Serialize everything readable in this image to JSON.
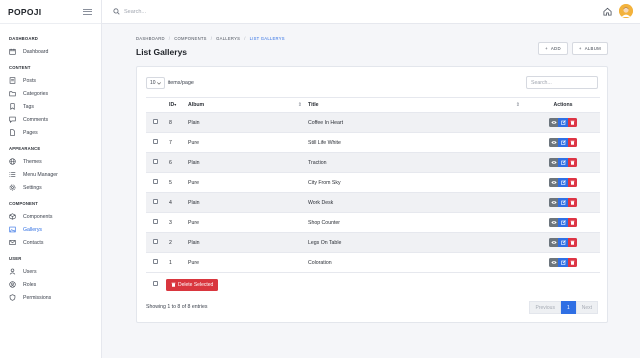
{
  "app": {
    "brand": "POPOJI"
  },
  "search": {
    "placeholder": "Search..."
  },
  "sidebar": {
    "sections": [
      {
        "title": "DASHBOARD",
        "items": [
          {
            "label": "Dashboard",
            "icon": "calendar-icon"
          }
        ]
      },
      {
        "title": "CONTENT",
        "items": [
          {
            "label": "Posts",
            "icon": "document-icon"
          },
          {
            "label": "Categories",
            "icon": "folder-icon"
          },
          {
            "label": "Tags",
            "icon": "bookmark-icon"
          },
          {
            "label": "Comments",
            "icon": "comment-icon"
          },
          {
            "label": "Pages",
            "icon": "page-icon"
          }
        ]
      },
      {
        "title": "APPEARANCE",
        "items": [
          {
            "label": "Themes",
            "icon": "globe-icon"
          },
          {
            "label": "Menu Manager",
            "icon": "list-icon"
          },
          {
            "label": "Settings",
            "icon": "gear-icon"
          }
        ]
      },
      {
        "title": "COMPONENT",
        "items": [
          {
            "label": "Components",
            "icon": "box-icon"
          },
          {
            "label": "Gallerys",
            "icon": "image-icon",
            "active": true
          },
          {
            "label": "Contacts",
            "icon": "mail-icon"
          }
        ]
      },
      {
        "title": "USER",
        "items": [
          {
            "label": "Users",
            "icon": "user-icon"
          },
          {
            "label": "Roles",
            "icon": "roles-icon"
          },
          {
            "label": "Permissions",
            "icon": "shield-icon"
          }
        ]
      }
    ]
  },
  "breadcrumb": {
    "items": [
      "DASHBOARD",
      "COMPONENTS",
      "GALLERYS"
    ],
    "current": "LIST GALLERYS"
  },
  "page": {
    "title": "List Gallerys",
    "add_label": "ADD",
    "add_album_label": "ALBUM"
  },
  "table": {
    "per_page": "10",
    "per_page_label": "items/page",
    "search_placeholder": "Search...",
    "columns": {
      "id": "ID",
      "album": "Album",
      "title": "Title",
      "actions": "Actions"
    },
    "rows": [
      {
        "id": "8",
        "album": "Plain",
        "title": "Coffee In Heart"
      },
      {
        "id": "7",
        "album": "Pure",
        "title": "Still Life White"
      },
      {
        "id": "6",
        "album": "Plain",
        "title": "Traction"
      },
      {
        "id": "5",
        "album": "Pure",
        "title": "City From Sky"
      },
      {
        "id": "4",
        "album": "Plain",
        "title": "Work Desk"
      },
      {
        "id": "3",
        "album": "Pure",
        "title": "Shop Counter"
      },
      {
        "id": "2",
        "album": "Plain",
        "title": "Legs On Table"
      },
      {
        "id": "1",
        "album": "Pure",
        "title": "Coloration"
      }
    ],
    "delete_selected_label": "Delete Selected",
    "info": "Showing 1 to 8 of 8 entries",
    "pagination": {
      "previous": "Previous",
      "page": "1",
      "next": "Next"
    }
  },
  "colors": {
    "primary": "#2f6fe4",
    "danger": "#dc3545",
    "secondary": "#6c757d"
  }
}
